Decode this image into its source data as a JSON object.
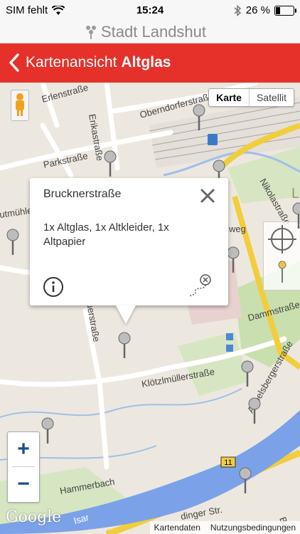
{
  "status": {
    "carrier": "SIM fehlt",
    "time": "15:24",
    "battery_text": "26 %",
    "battery_level": 0.26
  },
  "app": {
    "logo_text": "Stadt Landshut"
  },
  "nav": {
    "back_label": "Kartenansicht",
    "title": "Altglas"
  },
  "map": {
    "maptype_active": "Karte",
    "maptype_other": "Satellit",
    "zoom_in": "+",
    "zoom_out": "−",
    "google": "Google",
    "footer": [
      "Kartendaten",
      "Nutzungsbedingungen"
    ],
    "street_labels": {
      "erlenstrasse": "Erlenstraße",
      "erikastrasse": "Erikastraße",
      "oberndorfer": "Oberndorferstraße",
      "parkstrasse": "Parkstraße",
      "nikolastrasse": "Nikolastraße",
      "dammstrasse": "Dammstraße",
      "kloetzl": "Klötzlmüllerstraße",
      "uerstrasse": "uerstraße",
      "hammerbach": "Hammerbach",
      "isar": "Isar",
      "aebelsberger": "Aebelsbergerstraße",
      "dinger": "dinger Str.",
      "utmuhle": "utmühle",
      "weg": "weg",
      "ba": "Ba",
      "l": "L",
      "route11": "11"
    }
  },
  "info": {
    "title": "Brucknerstraße",
    "text": "1x Altglas, 1x Altkleider, 1x Altpapier"
  },
  "colors": {
    "nav_red": "#e53129",
    "highway_yellow": "#f2cd3c",
    "river_blue": "#7ba2e8"
  }
}
